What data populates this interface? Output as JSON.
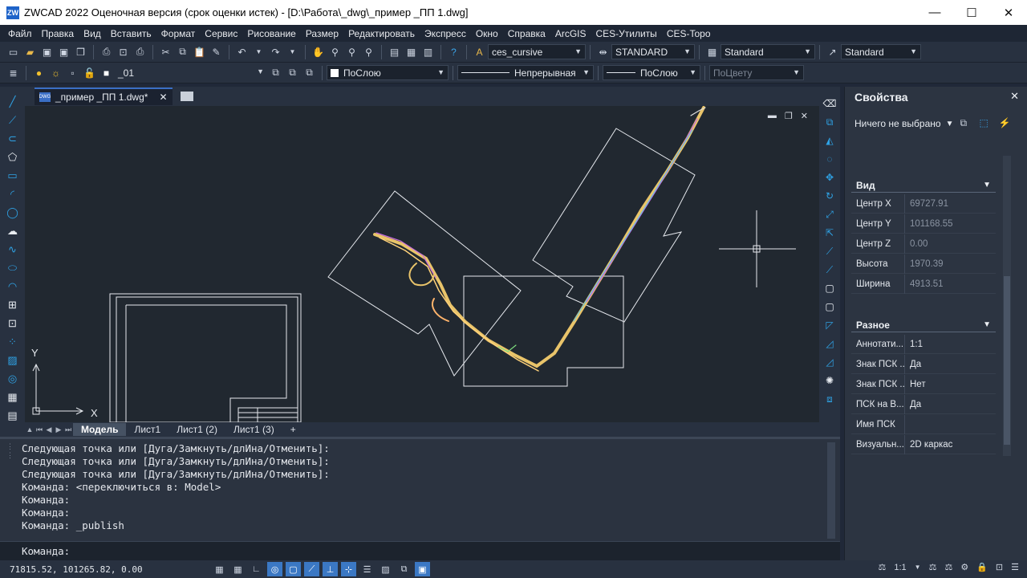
{
  "window": {
    "title": "ZWCAD 2022 Оценочная версия (срок оценки истек) - [D:\\Работа\\_dwg\\_пример _ПП 1.dwg]",
    "app_icon_label": "ZW",
    "controls": {
      "minimize": "—",
      "maximize": "☐",
      "close": "✕"
    }
  },
  "menu": [
    "Файл",
    "Правка",
    "Вид",
    "Вставить",
    "Формат",
    "Сервис",
    "Рисование",
    "Размер",
    "Редактировать",
    "Экспресс",
    "Окно",
    "Справка",
    "ArcGIS",
    "CES-Утилиты",
    "CES-Topo"
  ],
  "toolbar1": {
    "text_style": "ces_cursive",
    "dim_style": "STANDARD",
    "table_style": "Standard",
    "mleader_style": "Standard"
  },
  "toolbar2": {
    "layer": "_01",
    "color": "ПоСлою",
    "linetype": "Непрерывная",
    "lineweight": "ПоСлою",
    "plotstyle": "ПоЦвету"
  },
  "document_tab": {
    "label": "_пример _ПП 1.dwg*",
    "close": "✕"
  },
  "viewport_controls": {
    "minimize": "▬",
    "restore": "❐",
    "close": "✕"
  },
  "ucs": {
    "x_label": "X",
    "y_label": "Y"
  },
  "layout_tabs": [
    "Модель",
    "Лист1",
    "Лист1 (2)",
    "Лист1 (3)",
    "+"
  ],
  "active_layout": "Модель",
  "command_history": [
    "Следующая точка или [Дуга/Замкнуть/длИна/Отменить]:",
    "Следующая точка или [Дуга/Замкнуть/длИна/Отменить]:",
    "Следующая точка или [Дуга/Замкнуть/длИна/Отменить]:",
    "Команда: <переключиться в: Model>",
    "Команда:",
    "Команда:",
    "Команда: _publish"
  ],
  "command_prompt": "Команда:",
  "status": {
    "coords": "71815.52, 101265.82, 0.00",
    "scale": "1:1"
  },
  "properties": {
    "title": "Свойства",
    "close": "✕",
    "selection": "Ничего не выбрано",
    "section_view": "Вид",
    "view_rows": [
      {
        "key": "Центр X",
        "value": "69727.91"
      },
      {
        "key": "Центр Y",
        "value": "101168.55"
      },
      {
        "key": "Центр Z",
        "value": "0.00"
      },
      {
        "key": "Высота",
        "value": "1970.39"
      },
      {
        "key": "Ширина",
        "value": "4913.51"
      }
    ],
    "section_misc": "Разное",
    "misc_rows": [
      {
        "key": "Аннотати...",
        "value": "1:1"
      },
      {
        "key": "Знак ПСК ...",
        "value": "Да"
      },
      {
        "key": "Знак ПСК ...",
        "value": "Нет"
      },
      {
        "key": "ПСК на В...",
        "value": "Да"
      },
      {
        "key": "Имя ПСК",
        "value": ""
      },
      {
        "key": "Визуальн...",
        "value": "2D каркас"
      }
    ]
  }
}
